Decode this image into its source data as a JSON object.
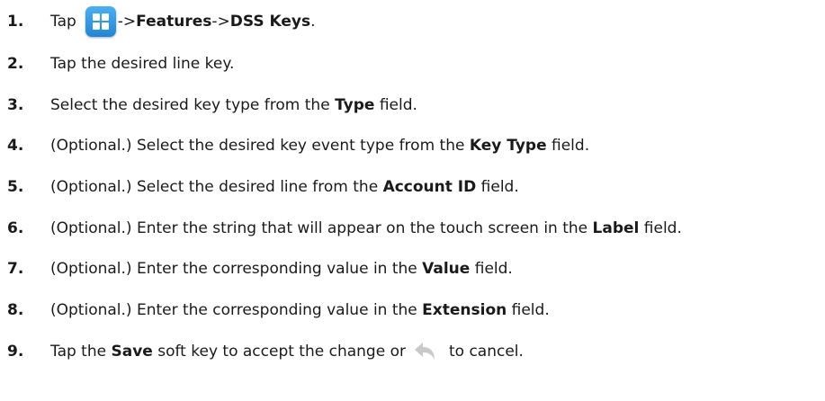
{
  "steps": [
    {
      "num": "1.",
      "a": "Tap",
      "b": "->",
      "c": "Features",
      "d": "->",
      "e": "DSS Keys",
      "f": "."
    },
    {
      "num": "2.",
      "a": "Tap the desired line key."
    },
    {
      "num": "3.",
      "a": "Select the desired key type from the ",
      "b": "Type",
      "c": " field."
    },
    {
      "num": "4.",
      "a": "(Optional.) Select the desired key event type from the ",
      "b": "Key Type",
      "c": " field."
    },
    {
      "num": "5.",
      "a": "(Optional.) Select the desired line from the ",
      "b": "Account ID",
      "c": " field."
    },
    {
      "num": "6.",
      "a": "(Optional.) Enter the string that will appear on the touch screen in the ",
      "b": "Label",
      "c": " field."
    },
    {
      "num": "7.",
      "a": "(Optional.) Enter the corresponding value in the ",
      "b": "Value",
      "c": " field."
    },
    {
      "num": "8.",
      "a": "(Optional.) Enter the corresponding value in the ",
      "b": "Extension",
      "c": " field."
    },
    {
      "num": "9.",
      "a": "Tap the ",
      "b": "Save",
      "c": " soft key to accept the change or",
      "d": "to cancel."
    }
  ],
  "icons": {
    "menu": "menu-grid-icon",
    "back": "back-arrow-icon"
  },
  "colors": {
    "icon_blue": "#1e86d8",
    "back_grey": "#c9c9c9"
  }
}
